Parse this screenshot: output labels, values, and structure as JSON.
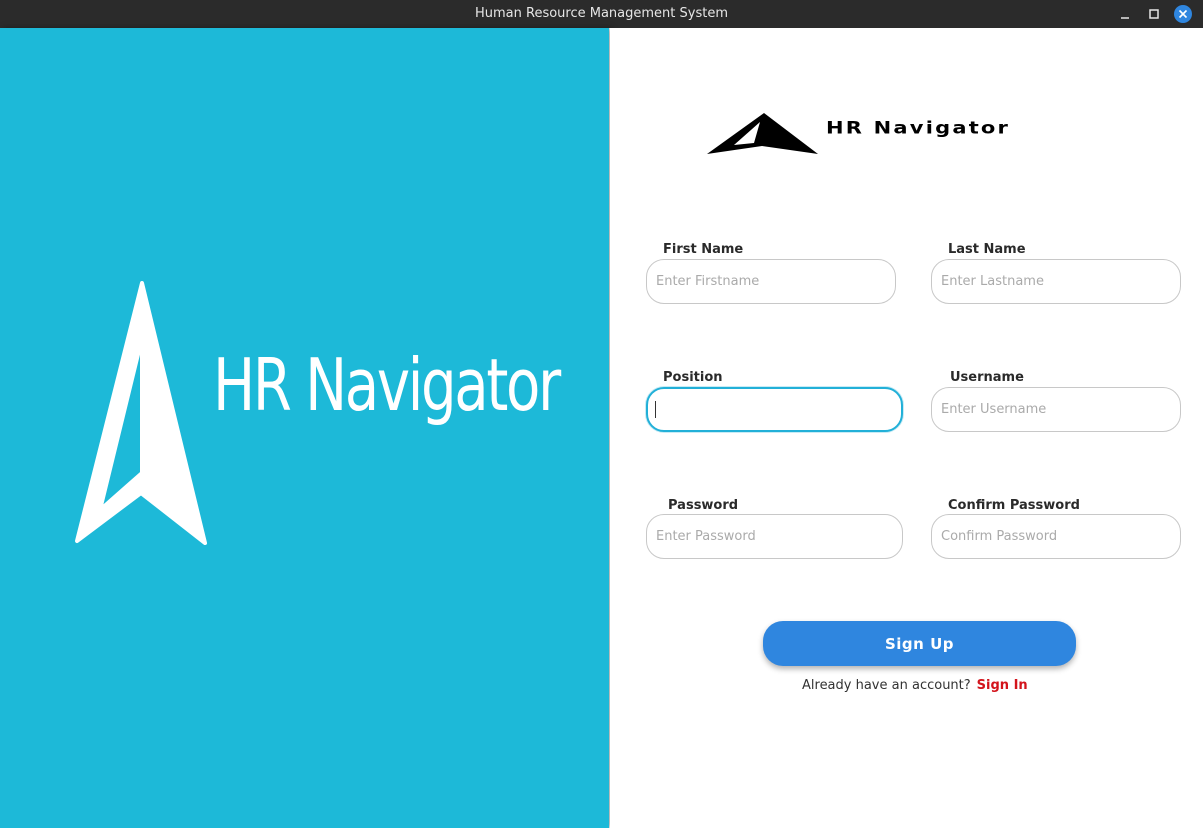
{
  "window": {
    "title": "Human Resource Management System"
  },
  "brand": {
    "name": "HR Navigator",
    "primary_color": "#1db9d8",
    "accent_color": "#2f86df",
    "link_color": "#d3141c"
  },
  "form": {
    "first_name": {
      "label": "First Name",
      "placeholder": "Enter Firstname",
      "value": ""
    },
    "last_name": {
      "label": "Last Name",
      "placeholder": "Enter Lastname",
      "value": ""
    },
    "position": {
      "label": "Position",
      "placeholder": "",
      "value": ""
    },
    "username": {
      "label": "Username",
      "placeholder": "Enter Username",
      "value": ""
    },
    "password": {
      "label": "Password",
      "placeholder": "Enter Password",
      "value": ""
    },
    "confirm_password": {
      "label": "Confirm Password",
      "placeholder": "Confirm Password",
      "value": ""
    },
    "submit_label": "Sign Up",
    "signin_prompt": "Already have an account?",
    "signin_link": "Sign In"
  },
  "icons": {
    "window_minimize": "minimize-icon",
    "window_maximize": "maximize-icon",
    "window_close": "close-icon",
    "logo": "navigator-arrow-icon"
  }
}
